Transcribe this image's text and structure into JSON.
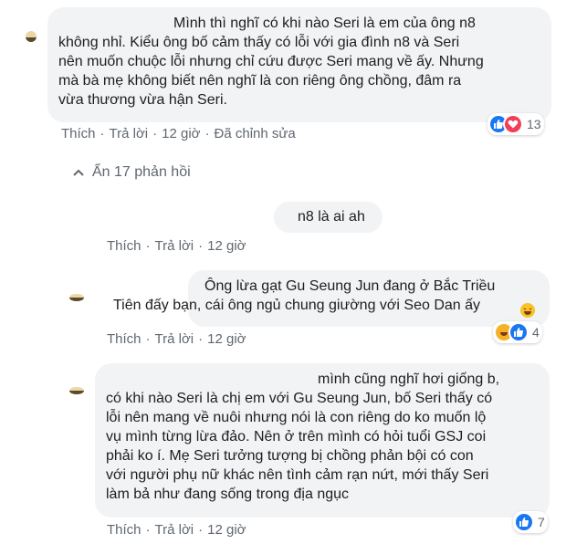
{
  "comments": [
    {
      "lines": [
        "Mình thì nghĩ có khi nào Seri là em của ông n8",
        "không nhỉ. Kiểu ông bố cảm thấy có lỗi với gia đình n8 và Seri",
        "nên muốn chuộc lỗi nhưng chỉ cứu được Seri mang về ấy. Nhưng",
        "mà bà mẹ không biết nên nghĩ là con riêng ông chồng, đâm ra",
        "vừa thương vừa hận Seri."
      ],
      "actions": {
        "like": "Thích",
        "reply": "Trả lời",
        "time": "12 giờ",
        "edited": "Đã chỉnh sửa"
      },
      "reactions": {
        "count": "13",
        "icons": [
          "like-icon",
          "love-icon"
        ]
      }
    }
  ],
  "toggle": {
    "label": "Ẩn 17 phản hồi",
    "icon": "chevron-up-icon"
  },
  "replies": [
    {
      "lines": [
        "n8 là ai ah"
      ],
      "actions": {
        "like": "Thích",
        "reply": "Trả lời",
        "time": "12 giờ"
      }
    },
    {
      "lines": [
        "Ông lừa gạt Gu Seung Jun đang ở Bắc Triều",
        "Tiên đấy bạn, cái ông ngủ chung giường với Seo Dan ấy"
      ],
      "actions": {
        "like": "Thích",
        "reply": "Trả lời",
        "time": "12 giờ"
      },
      "reactions": {
        "count": "4",
        "icons": [
          "haha-icon",
          "like-icon"
        ]
      }
    },
    {
      "lines": [
        "mình cũng nghĩ hơi giống b,",
        "có khi nào Seri là chị em với Gu Seung Jun, bố Seri thấy có",
        "lỗi nên mang về nuôi nhưng nói là con riêng do ko muốn lộ",
        "vụ mình từng lừa đảo. Nên ở trên mình có hỏi tuổi GSJ coi",
        "phải ko í. Mẹ Seri tưởng tượng bị chồng phản bội có con",
        "với người phụ nữ khác nên tình cảm rạn nứt, mới thấy Seri",
        "làm bả như đang sống trong địa ngục"
      ],
      "actions": {
        "like": "Thích",
        "reply": "Trả lời",
        "time": "12 giờ"
      },
      "reactions": {
        "count": "7",
        "icons": [
          "like-icon"
        ]
      }
    }
  ],
  "colors": {
    "bubble": "#f2f3f5",
    "meta_text": "#606770",
    "link": "#385898",
    "like": "#1877f2",
    "love": "#f33e58",
    "haha": "#f7b125"
  }
}
